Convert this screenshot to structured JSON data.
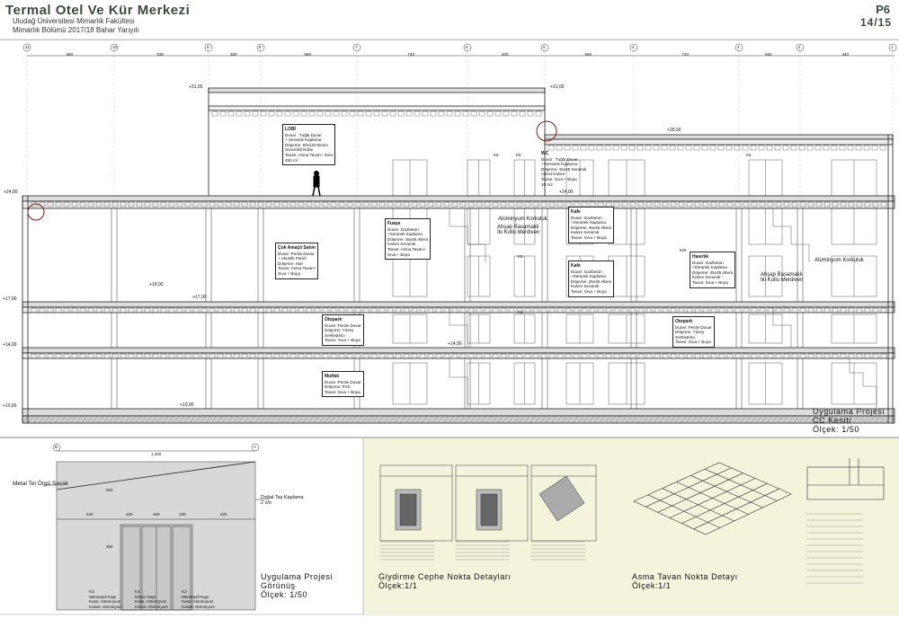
{
  "header": {
    "title": "Termal Otel Ve Kür Merkezi",
    "subtitle1": "Uludağ Üniversitesi Mimarlık Fakültesi",
    "subtitle2": "Mimarlık Bölümü 2017/18 Bahar Yarıyılı",
    "sheet_code": "P6",
    "sheet_no": "14/15"
  },
  "grid": {
    "axes": [
      "11",
      "10",
      "9",
      "8",
      "7",
      "6",
      "5",
      "4",
      "3",
      "2",
      "1"
    ],
    "dims": [
      "580",
      "630",
      "380",
      "580",
      "740",
      "500",
      "580",
      "720",
      "560",
      "440"
    ]
  },
  "levels": [
    "+31,00",
    "+28,00",
    "+24,00",
    "+18,00",
    "+17,00",
    "+17,00",
    "+14,00",
    "+14,00",
    "+10,00",
    "+10,00",
    "+31,00",
    "+24,00"
  ],
  "rooms": [
    {
      "title": "LOBİ",
      "text": "Duvar : Tuğla Duvar\n+ Seramik Kaplama\nDöşeme: 60x120 Beton\nSeramikli Nobe\nTavan: Asma Tavan+ Sıva\n450 m²"
    },
    {
      "title": "WC",
      "text": "Duvar : Tuğla Duvar\n+ Seramik Kaplama\nDöşeme: 45x45 Seramik\nAltera Kalvre\nTavan: Sıva + Boya\n10 m2"
    },
    {
      "title": "Fuaye",
      "text": "Duvar :Gazbeton\n+Seramik Kaplama\nDöşeme: 45x45 Altera\nKalvre Seramik\nTavan: Asma Tavan+\nSıva + Boya"
    },
    {
      "title": "Kafe",
      "text": "Duvar :Gazbeton\n+Seramik Kaplama\nDöşeme: 45x45 Altera\nKalvre Seramik\nTavan: Sıva + Boya"
    },
    {
      "title": "Kafe",
      "text": "Duvar :Gazbeton\n+Seramik Kaplama\nDöşeme: 45x45 Altera\nKalvre Seramik\nTavan: Sıva + Boya"
    },
    {
      "title": "Çok Amaçlı Salon",
      "text": "Duvar :Perde Duvar\n+ Akustik Panel\nDöşeme: Halı\nTavan: Asma Tavan+\nSıva + Boya"
    },
    {
      "title": "Hasırlık",
      "text": "Duvar :Gazbeton\n+Seramik Kaplama\nDöşeme: 45x45 Altera\nKalvre Seramik\nTavan: Sıva + Boya"
    },
    {
      "title": "Otopark",
      "text": "Duvar :Perde Duvar\nDöşeme: Yüzey\nSertleştirici\nTavan: Sıva + Boya"
    },
    {
      "title": "Otopark",
      "text": "Duvar :Perde Duvar\nDöşeme: Yüzey\nSertleştirici\nTavan: Sıva + Boya"
    },
    {
      "title": "Mutfak",
      "text": "Duvar :Perde Duvar\nDöşeme: PVC\nTavan: Sıva + Boya"
    }
  ],
  "section_labels": {
    "corr1": "Alüminyum Korkuluk",
    "stair1": "Ahşap Basamaklı\nİki Kollu Merdiven",
    "corr2": "Alüminyum Korkuluk",
    "stair2": "Ahşap Basamaklı\nİki Kollu Merdiven",
    "dim525": "525",
    "k_tags": [
      "K5",
      "K6",
      "K6",
      "K6",
      "K5"
    ]
  },
  "section_title": {
    "line1": "Uygulama Projesi",
    "line2": "CC Kesiti",
    "line3": "Ölçek: 1/50"
  },
  "elevation": {
    "axes": [
      "B",
      "A"
    ],
    "total": "1.300",
    "sub_dims": [
      "420",
      "100",
      "260",
      "100",
      "420"
    ],
    "v_dims": [
      "620",
      "300"
    ],
    "note_left": "Metal Tel Örgü Saçak",
    "note_right": "Doğal Taş Kaplama\n2 cm",
    "doors": [
      {
        "code": "K3",
        "text": "Menteşeli Kapı\nKasa: Alüminyum\nKanat: Alüminyum"
      },
      {
        "code": "K4",
        "text": "Döner Kapı\nKasa: Alüminyum\nKanat: Alüminyum"
      },
      {
        "code": "K3",
        "text": "Menteşeli Kapı\nKasa: Alüminyum\nKanat: Alüminyum"
      }
    ],
    "title1": "Uygulama Projesi",
    "title2": "Görünüş",
    "title3": "Ölçek: 1/50"
  },
  "detail1": {
    "title": "Giydirme Cephe Nokta Detayları",
    "scale": "Ölçek:1/1"
  },
  "detail2": {
    "title": "Asma Tavan Nokta Detayı",
    "scale": "Ölçek:1/1"
  },
  "colors": {
    "header": "#3c4a3c",
    "panel_bg": "#f4f3dc",
    "line": "#222222",
    "mark": "#7a1a1a"
  }
}
